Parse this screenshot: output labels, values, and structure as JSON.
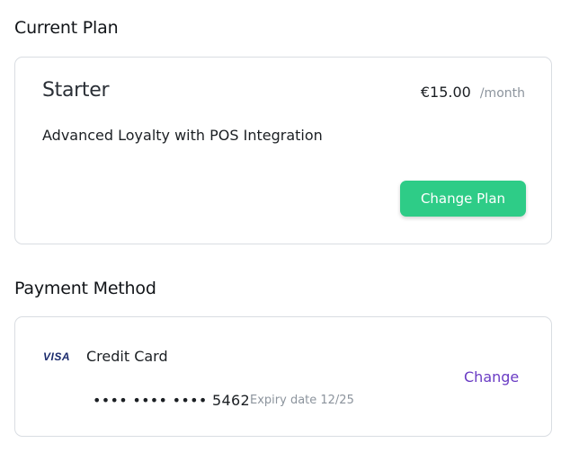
{
  "current_plan": {
    "section_title": "Current Plan",
    "plan_name": "Starter",
    "price": "€15.00",
    "period": "/month",
    "description": "Advanced Loyalty with POS Integration",
    "change_plan_label": "Change Plan"
  },
  "payment_method": {
    "section_title": "Payment Method",
    "card_brand": "VISA",
    "card_type": "Credit Card",
    "masked_number": "•••• •••• •••• 5462",
    "expiry": "Expiry date 12/25",
    "change_label": "Change"
  },
  "colors": {
    "accent_green": "#2ecc87",
    "link_purple": "#6a3cc4",
    "visa_blue": "#1a2a6c",
    "muted_text": "#8c949d"
  }
}
